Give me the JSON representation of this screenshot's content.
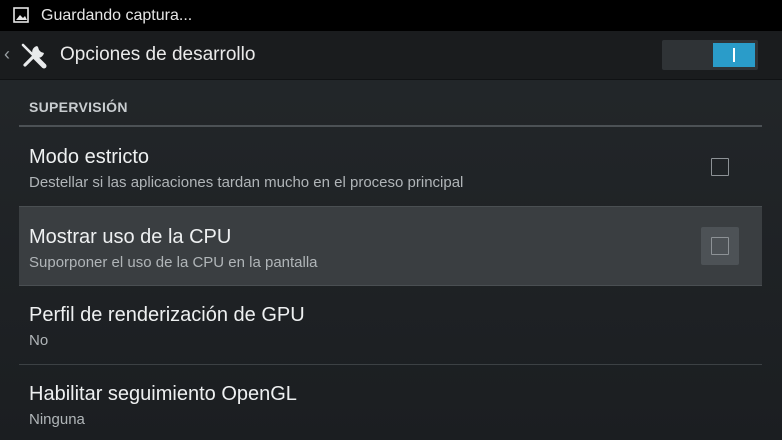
{
  "status_bar": {
    "notification_text": "Guardando captura...",
    "icon": "image-icon"
  },
  "action_bar": {
    "up_icon": "chevron-left-icon",
    "app_icon": "tools-icon",
    "title": "Opciones de desarrollo",
    "master_switch": {
      "state": "on",
      "accent": "#2a9cc9"
    }
  },
  "section": {
    "header": "SUPERVISIÓN"
  },
  "prefs": [
    {
      "title": "Modo estricto",
      "summary": "Destellar si las aplicaciones tardan mucho en el proceso principal",
      "checkbox": true,
      "checked": false
    },
    {
      "title": "Mostrar uso de la CPU",
      "summary": "Suporponer el uso de la CPU en la pantalla",
      "checkbox": true,
      "checked": false,
      "pressed": true
    },
    {
      "title": "Perfil de renderización de GPU",
      "summary": "No",
      "checkbox": false
    },
    {
      "title": "Habilitar seguimiento OpenGL",
      "summary": "Ninguna",
      "checkbox": false
    }
  ],
  "colors": {
    "background": "#1e2225",
    "accent": "#2a9cc9",
    "pressed_row": "#3a3e41"
  }
}
